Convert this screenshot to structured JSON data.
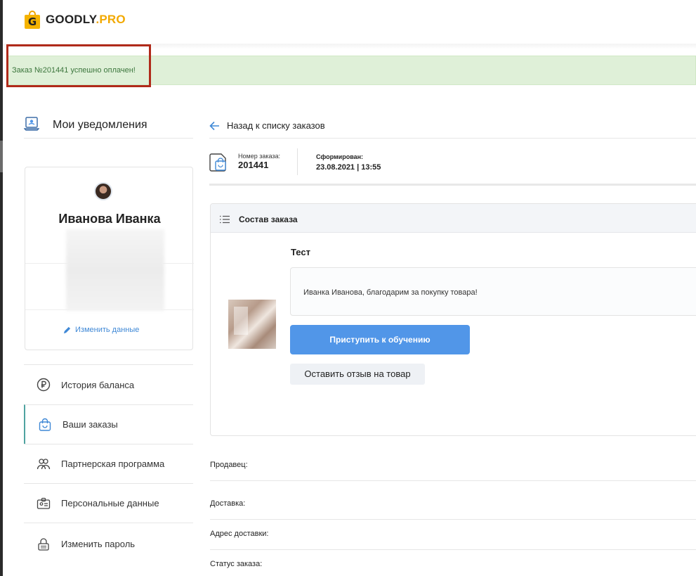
{
  "header": {
    "logo_letter": "G",
    "logo_main": "GOODLY",
    "logo_suffix": ".PRO"
  },
  "banner": {
    "message": "Заказ №201441 успешно оплачен!"
  },
  "sidebar": {
    "notifications_label": "Мои уведомления",
    "profile": {
      "name": "Иванова Иванка",
      "edit_label": "Изменить данные"
    },
    "menu": [
      {
        "label": "История баланса",
        "icon": "ruble-icon"
      },
      {
        "label": "Ваши заказы",
        "icon": "shopping-bag-icon"
      },
      {
        "label": "Партнерская программа",
        "icon": "partners-icon"
      },
      {
        "label": "Персональные данные",
        "icon": "id-card-icon"
      },
      {
        "label": "Изменить пароль",
        "icon": "lock-icon"
      }
    ],
    "active_index": 1
  },
  "main": {
    "back_label": "Назад к списку заказов",
    "order_number_label": "Номер заказа:",
    "order_number": "201441",
    "created_label": "Сформирован:",
    "created_value": "23.08.2021 | 13:55",
    "panel_title": "Состав заказа",
    "product": {
      "title": "Тест",
      "message": "Иванка Иванова, благодарим за покупку товара!",
      "start_button": "Приступить к обучению",
      "review_button": "Оставить отзыв на товар"
    },
    "info_rows": [
      {
        "label": "Продавец:"
      },
      {
        "label": "Доставка:"
      },
      {
        "label": "Адрес доставки:"
      },
      {
        "label": "Статус заказа:"
      }
    ]
  },
  "colors": {
    "accent": "#5196e8",
    "logo_yellow": "#f5b300",
    "success_bg": "#dff0d8",
    "success_text": "#3c763d",
    "highlight_border": "#b02a1a",
    "link": "#3f88d6"
  }
}
